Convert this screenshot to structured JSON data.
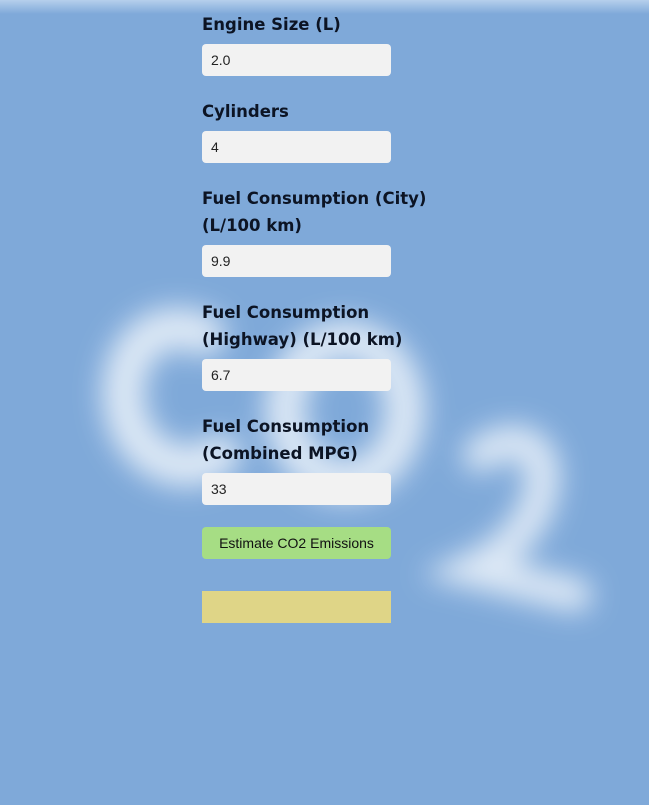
{
  "form": {
    "fields": [
      {
        "label": "Engine Size (L)",
        "value": "2.0"
      },
      {
        "label": "Cylinders",
        "value": "4"
      },
      {
        "label": "Fuel Consumption (City) (L/100 km)",
        "value": "9.9"
      },
      {
        "label": "Fuel Consumption (Highway) (L/100 km)",
        "value": "6.7"
      },
      {
        "label": "Fuel Consumption (Combined MPG)",
        "value": "33"
      }
    ],
    "submit_label": "Estimate CO2 Emissions",
    "result": ""
  },
  "colors": {
    "background": "#7fa9d9",
    "input_background": "#f2f2f2",
    "button_background": "#a6dd84",
    "result_background": "#dfd587"
  }
}
